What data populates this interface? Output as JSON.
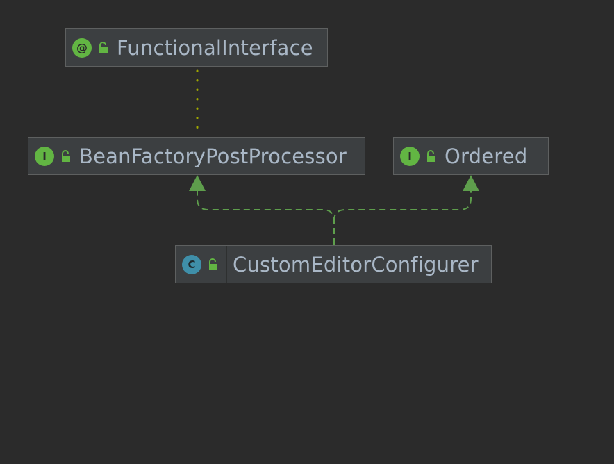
{
  "diagram": {
    "nodes": [
      {
        "id": "functional-interface",
        "kind": "annotation",
        "kind_glyph": "@",
        "label": "FunctionalInterface",
        "visibility_icon": "unlocked-icon"
      },
      {
        "id": "bean-factory-post-processor",
        "kind": "interface",
        "kind_glyph": "I",
        "label": "BeanFactoryPostProcessor",
        "visibility_icon": "unlocked-icon"
      },
      {
        "id": "ordered",
        "kind": "interface",
        "kind_glyph": "I",
        "label": "Ordered",
        "visibility_icon": "unlocked-icon"
      },
      {
        "id": "custom-editor-configurer",
        "kind": "class",
        "kind_glyph": "C",
        "label": "CustomEditorConfigurer",
        "visibility_icon": "unlocked-icon"
      }
    ],
    "edges": [
      {
        "from": "bean-factory-post-processor",
        "to": "functional-interface",
        "type": "annotated-by",
        "style": "dotted"
      },
      {
        "from": "custom-editor-configurer",
        "to": "bean-factory-post-processor",
        "type": "implements",
        "style": "dashed"
      },
      {
        "from": "custom-editor-configurer",
        "to": "ordered",
        "type": "implements",
        "style": "dashed"
      }
    ],
    "colors": {
      "background": "#2b2b2b",
      "node_fill": "#3c3f41",
      "node_border": "#5e6060",
      "label_text": "#a9b7c6",
      "interface_icon": "#62b543",
      "class_icon": "#3f8fa9",
      "implements_edge": "#5e9e4c",
      "annotation_edge": "#a0a800"
    }
  }
}
